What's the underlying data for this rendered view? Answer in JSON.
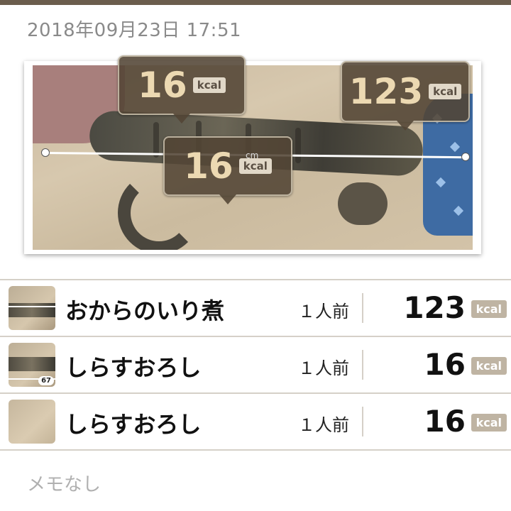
{
  "datetime": "2018年09月23日 17:51",
  "photo": {
    "bubbles": [
      {
        "value": "16",
        "unit": "kcal"
      },
      {
        "value": "123",
        "unit": "kcal"
      },
      {
        "value": "16",
        "unit": "kcal"
      }
    ],
    "measure_unit": "cm"
  },
  "items": [
    {
      "name": "おからのいり煮",
      "servings": "１人前",
      "kcal": "123",
      "unit": "kcal",
      "badge": ""
    },
    {
      "name": "しらすおろし",
      "servings": "１人前",
      "kcal": "16",
      "unit": "kcal",
      "badge": "67"
    },
    {
      "name": "しらすおろし",
      "servings": "１人前",
      "kcal": "16",
      "unit": "kcal",
      "badge": ""
    }
  ],
  "memo": "メモなし",
  "colors": {
    "accent": "#6b5d4d",
    "bubble_text": "#ecd9b2",
    "kcal_badge": "#bfb4a3"
  }
}
